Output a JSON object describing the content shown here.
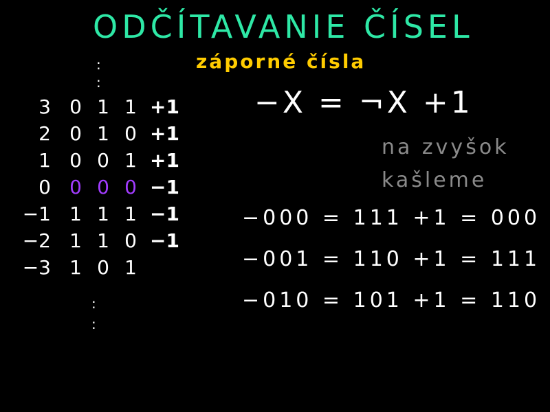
{
  "title": "ODČÍTAVANIE ČÍSEL",
  "subtitle": "záporné čísla",
  "formula": "−X = ¬X  +1",
  "note": {
    "line1": "na zvyšok",
    "line2": "kašleme"
  },
  "table": {
    "rows": [
      {
        "dec": "3",
        "bits": [
          "0",
          "1",
          "1"
        ],
        "step": "+1",
        "step_kind": "pos"
      },
      {
        "dec": "2",
        "bits": [
          "0",
          "1",
          "0"
        ],
        "step": "+1",
        "step_kind": "pos"
      },
      {
        "dec": "1",
        "bits": [
          "0",
          "0",
          "1"
        ],
        "step": "+1",
        "step_kind": "pos"
      },
      {
        "dec": "0",
        "bits": [
          "0",
          "0",
          "0"
        ],
        "step": "−1",
        "step_kind": "neg",
        "highlight": true
      },
      {
        "dec": "−1",
        "bits": [
          "1",
          "1",
          "1"
        ],
        "step": "−1",
        "step_kind": "neg"
      },
      {
        "dec": "−2",
        "bits": [
          "1",
          "1",
          "0"
        ],
        "step": "−1",
        "step_kind": "neg"
      },
      {
        "dec": "−3",
        "bits": [
          "1",
          "0",
          "1"
        ],
        "step": "",
        "step_kind": "none"
      }
    ],
    "dots_top": ":",
    "dots_bottom": ":"
  },
  "equations": [
    "−000 = 111 +1 = 000",
    "−001 = 110 +1 = 111",
    "−010 = 101 +1 = 110"
  ],
  "colors": {
    "title": "#2ee8a6",
    "subtitle": "#ffcc00",
    "highlight": "#a23cff",
    "plus": "#ff2f8d",
    "minus": "#2ee8a6",
    "note": "#8a8a8a"
  }
}
